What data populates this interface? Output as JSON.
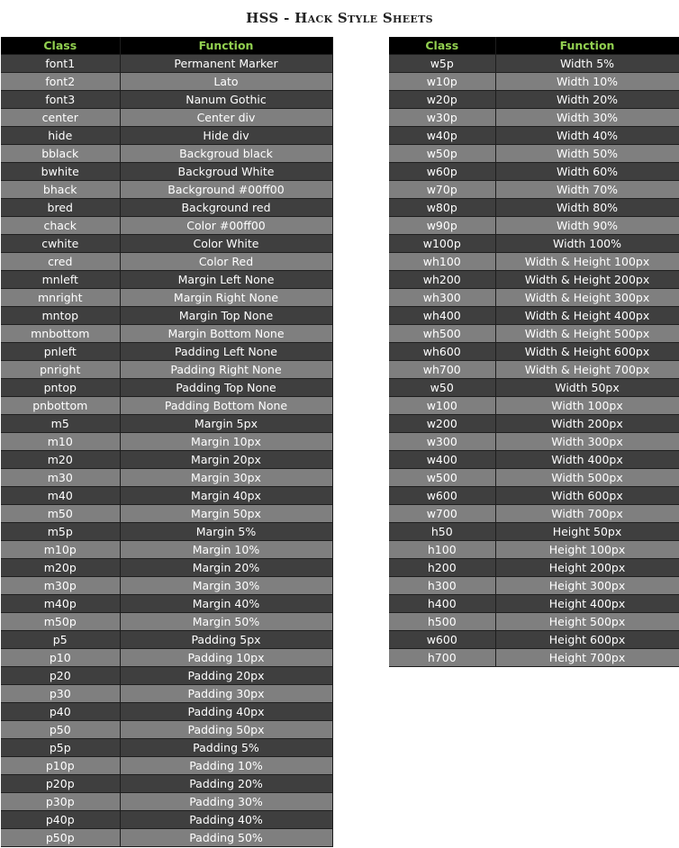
{
  "title": "HSS - Hack Style Sheets",
  "colors": {
    "header_background": "#000000",
    "header_text": "#92d050",
    "row_dark": "#3f3f3f",
    "row_light": "#7f7f7f",
    "cell_text": "#ffffff"
  },
  "tables": [
    {
      "headers": [
        "Class",
        "Function"
      ],
      "rows": [
        [
          "font1",
          "Permanent Marker"
        ],
        [
          "font2",
          "Lato"
        ],
        [
          "font3",
          "Nanum Gothic"
        ],
        [
          "center",
          "Center div"
        ],
        [
          "hide",
          "Hide div"
        ],
        [
          "bblack",
          "Backgroud black"
        ],
        [
          "bwhite",
          "Backgroud White"
        ],
        [
          "bhack",
          "Background #00ff00"
        ],
        [
          "bred",
          "Background red"
        ],
        [
          "chack",
          "Color #00ff00"
        ],
        [
          "cwhite",
          "Color White"
        ],
        [
          "cred",
          "Color Red"
        ],
        [
          "mnleft",
          "Margin Left None"
        ],
        [
          "mnright",
          "Margin Right None"
        ],
        [
          "mntop",
          "Margin Top None"
        ],
        [
          "mnbottom",
          "Margin Bottom None"
        ],
        [
          "pnleft",
          "Padding Left None"
        ],
        [
          "pnright",
          "Padding Right None"
        ],
        [
          "pntop",
          "Padding Top None"
        ],
        [
          "pnbottom",
          "Padding Bottom None"
        ],
        [
          "m5",
          "Margin 5px"
        ],
        [
          "m10",
          "Margin 10px"
        ],
        [
          "m20",
          "Margin 20px"
        ],
        [
          "m30",
          "Margin 30px"
        ],
        [
          "m40",
          "Margin 40px"
        ],
        [
          "m50",
          "Margin 50px"
        ],
        [
          "m5p",
          "Margin 5%"
        ],
        [
          "m10p",
          "Margin 10%"
        ],
        [
          "m20p",
          "Margin 20%"
        ],
        [
          "m30p",
          "Margin 30%"
        ],
        [
          "m40p",
          "Margin 40%"
        ],
        [
          "m50p",
          "Margin 50%"
        ],
        [
          "p5",
          "Padding 5px"
        ],
        [
          "p10",
          "Padding 10px"
        ],
        [
          "p20",
          "Padding 20px"
        ],
        [
          "p30",
          "Padding 30px"
        ],
        [
          "p40",
          "Padding 40px"
        ],
        [
          "p50",
          "Padding 50px"
        ],
        [
          "p5p",
          "Padding 5%"
        ],
        [
          "p10p",
          "Padding 10%"
        ],
        [
          "p20p",
          "Padding 20%"
        ],
        [
          "p30p",
          "Padding 30%"
        ],
        [
          "p40p",
          "Padding 40%"
        ],
        [
          "p50p",
          "Padding 50%"
        ]
      ]
    },
    {
      "headers": [
        "Class",
        "Function"
      ],
      "rows": [
        [
          "w5p",
          "Width 5%"
        ],
        [
          "w10p",
          "Width 10%"
        ],
        [
          "w20p",
          "Width 20%"
        ],
        [
          "w30p",
          "Width 30%"
        ],
        [
          "w40p",
          "Width 40%"
        ],
        [
          "w50p",
          "Width 50%"
        ],
        [
          "w60p",
          "Width 60%"
        ],
        [
          "w70p",
          "Width 70%"
        ],
        [
          "w80p",
          "Width 80%"
        ],
        [
          "w90p",
          "Width 90%"
        ],
        [
          "w100p",
          "Width 100%"
        ],
        [
          "wh100",
          "Width & Height 100px"
        ],
        [
          "wh200",
          "Width & Height 200px"
        ],
        [
          "wh300",
          "Width & Height 300px"
        ],
        [
          "wh400",
          "Width & Height 400px"
        ],
        [
          "wh500",
          "Width & Height 500px"
        ],
        [
          "wh600",
          "Width & Height 600px"
        ],
        [
          "wh700",
          "Width & Height 700px"
        ],
        [
          "w50",
          "Width 50px"
        ],
        [
          "w100",
          "Width 100px"
        ],
        [
          "w200",
          "Width 200px"
        ],
        [
          "w300",
          "Width 300px"
        ],
        [
          "w400",
          "Width 400px"
        ],
        [
          "w500",
          "Width 500px"
        ],
        [
          "w600",
          "Width 600px"
        ],
        [
          "w700",
          "Width 700px"
        ],
        [
          "h50",
          "Height 50px"
        ],
        [
          "h100",
          "Height 100px"
        ],
        [
          "h200",
          "Height 200px"
        ],
        [
          "h300",
          "Height 300px"
        ],
        [
          "h400",
          "Height 400px"
        ],
        [
          "h500",
          "Height 500px"
        ],
        [
          "w600",
          "Height 600px"
        ],
        [
          "h700",
          "Height 700px"
        ]
      ]
    }
  ]
}
